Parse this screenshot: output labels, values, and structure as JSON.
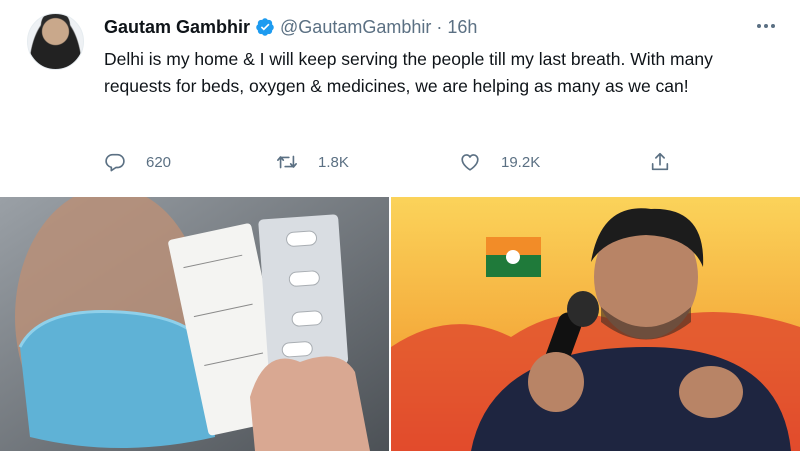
{
  "tweet": {
    "author_name": "Gautam Gambhir",
    "handle": "@GautamGambhir",
    "time_sep": "·",
    "time": "16h",
    "text": "Delhi is my home & I will keep serving the people till my last breath. With many requests for beds, oxygen & medicines, we are helping as many as we can!",
    "actions": {
      "reply_count": "620",
      "retweet_count": "1.8K",
      "like_count": "19.2K"
    }
  },
  "icons": {
    "verified": "verified-badge-icon",
    "more": "more-options-icon",
    "reply": "reply-icon",
    "retweet": "retweet-icon",
    "like": "heart-icon",
    "share": "share-icon"
  },
  "colors": {
    "verified_blue": "#1d9bf0",
    "muted_text": "#5b7083",
    "text": "#0f1419"
  }
}
